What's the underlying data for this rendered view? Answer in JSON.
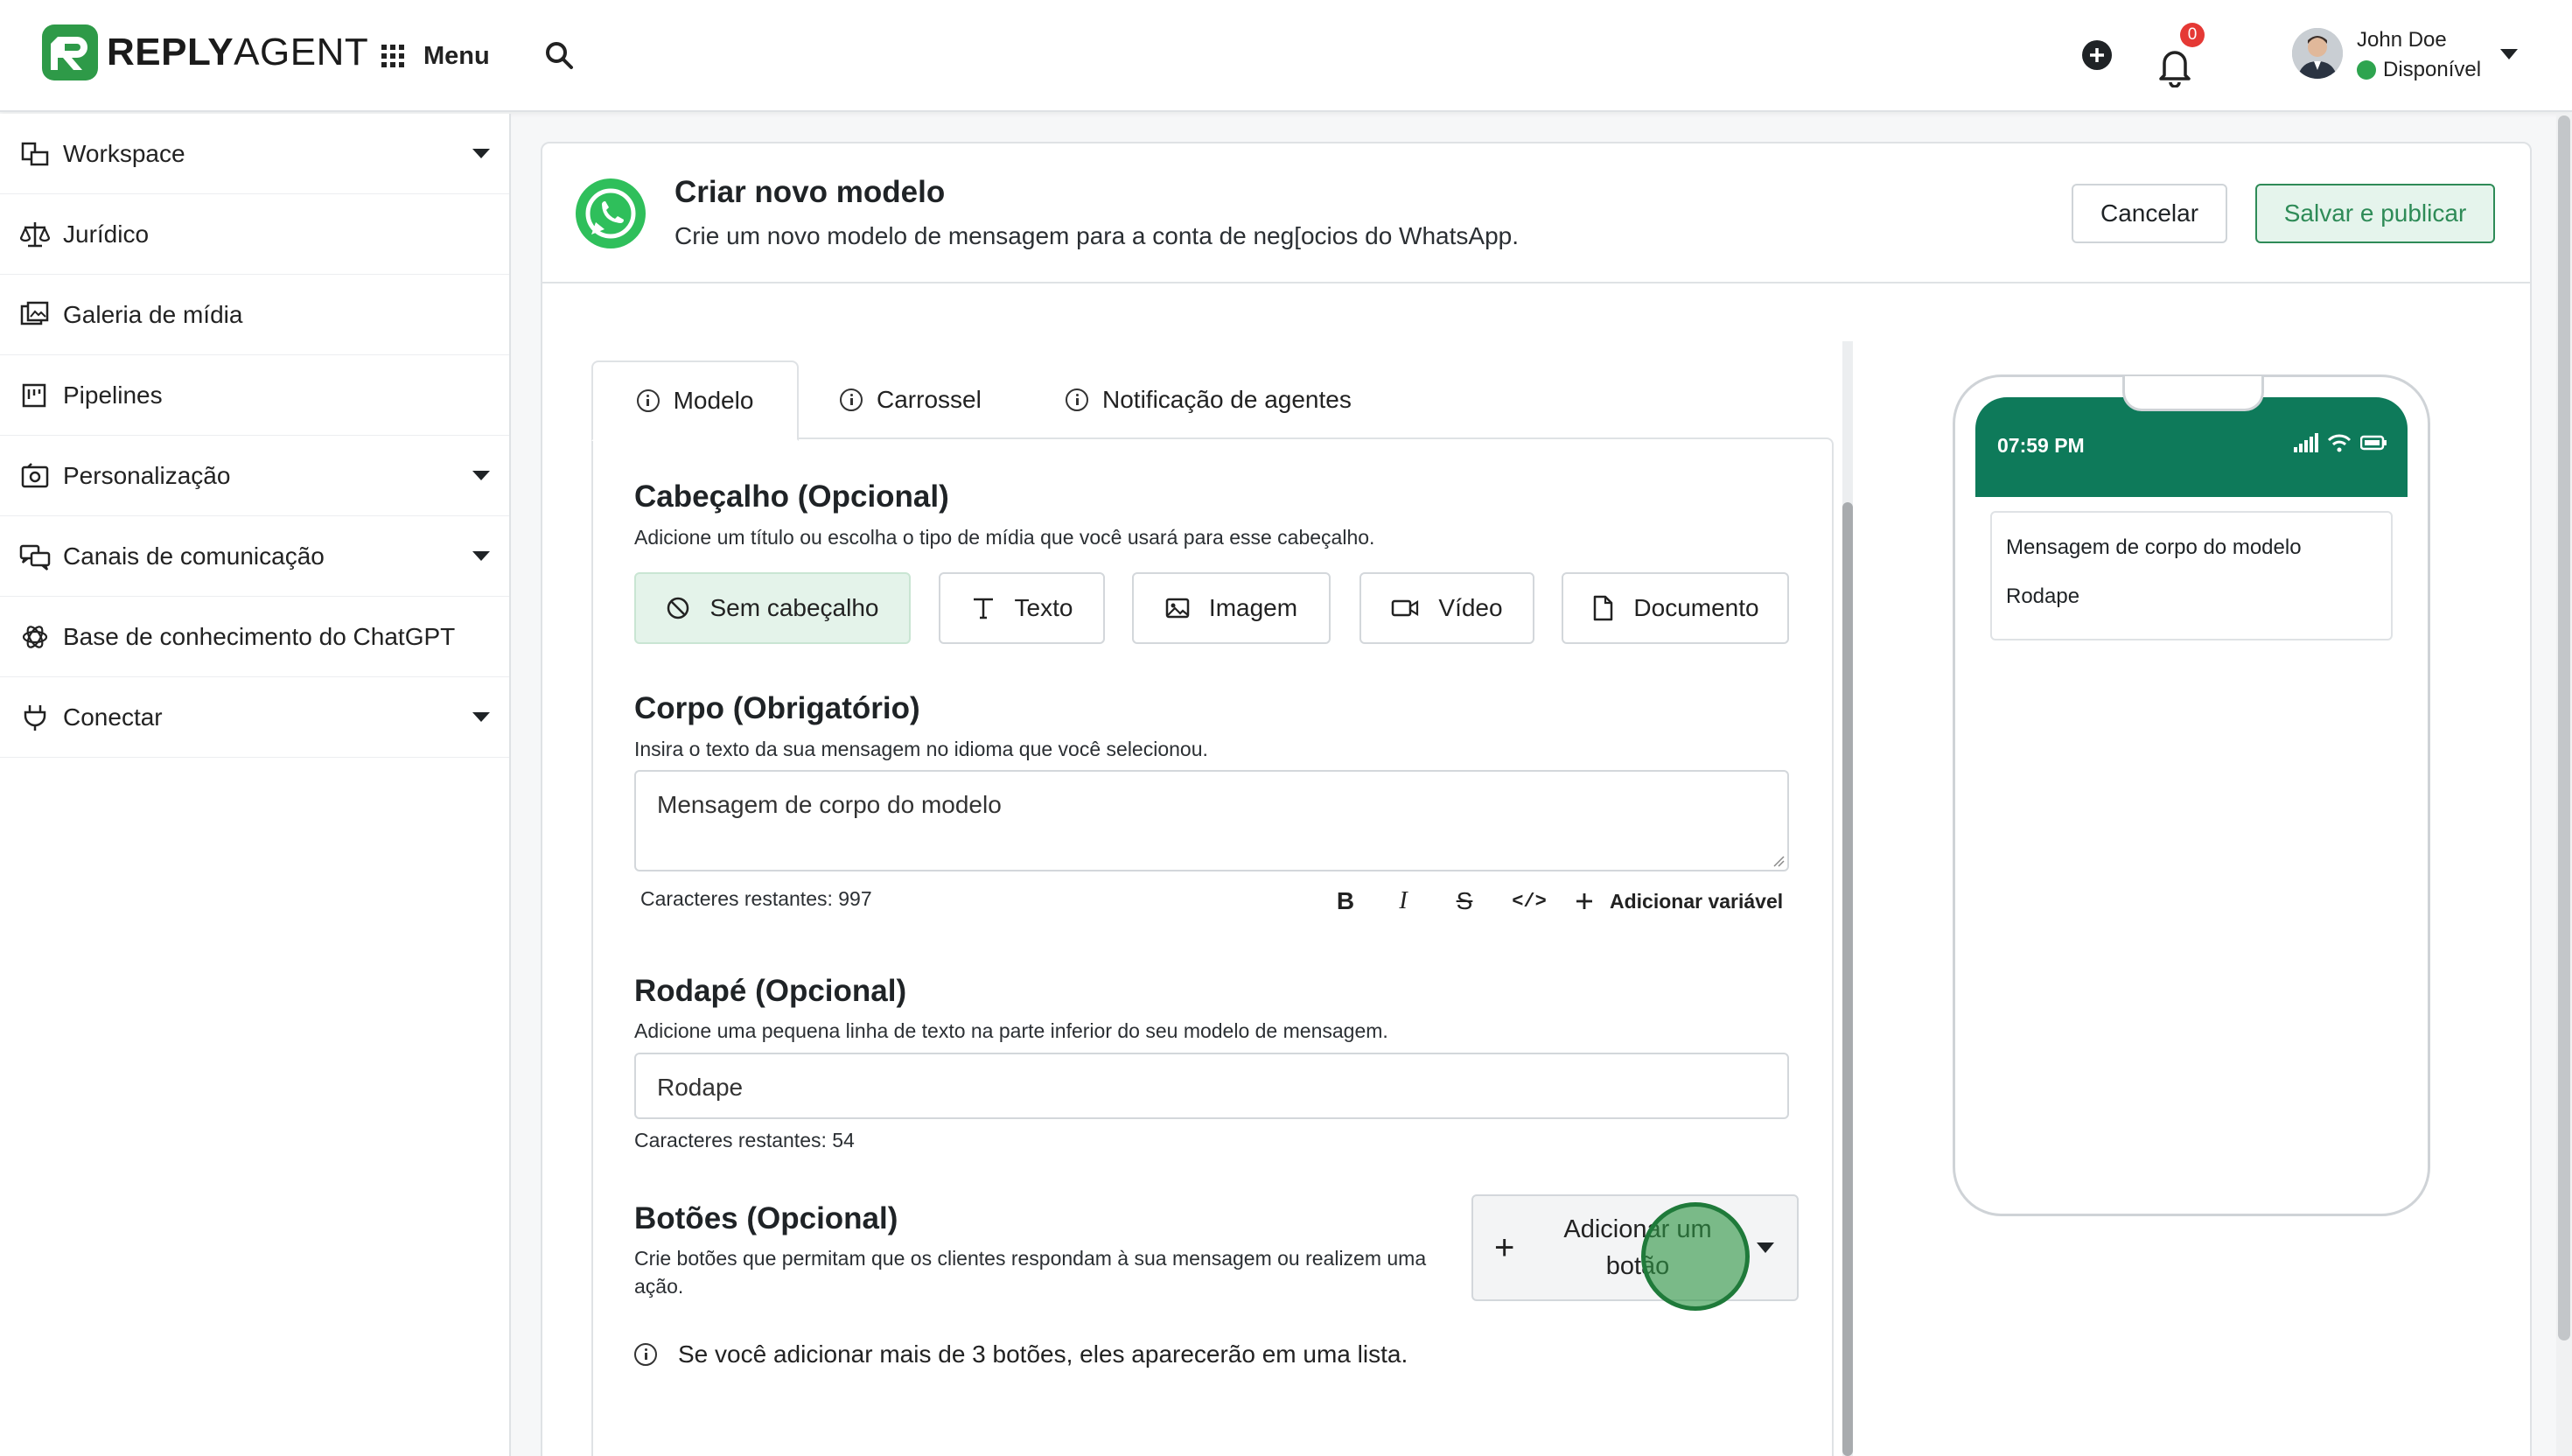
{
  "app": {
    "logo_bold": "REPLY",
    "logo_light": "AGENT",
    "menu_label": "Menu"
  },
  "header": {
    "notifications_count": "0",
    "user_name": "John Doe",
    "user_status": "Disponível"
  },
  "sidebar": {
    "items": [
      {
        "label": "Workspace",
        "icon": "workspace-icon",
        "expandable": true
      },
      {
        "label": "Jurídico",
        "icon": "scale-icon",
        "expandable": false
      },
      {
        "label": "Galeria de mídia",
        "icon": "media-gallery-icon",
        "expandable": false
      },
      {
        "label": "Pipelines",
        "icon": "kanban-icon",
        "expandable": false
      },
      {
        "label": "Personalização",
        "icon": "customize-icon",
        "expandable": true
      },
      {
        "label": "Canais de comunicação",
        "icon": "chat-channels-icon",
        "expandable": true
      },
      {
        "label": "Base de conhecimento do ChatGPT",
        "icon": "openai-icon",
        "expandable": false
      },
      {
        "label": "Conectar",
        "icon": "plug-icon",
        "expandable": true
      }
    ]
  },
  "page": {
    "title": "Criar novo modelo",
    "subtitle": "Crie um novo modelo de mensagem para a conta de neg[ocios do WhatsApp.",
    "cancel_label": "Cancelar",
    "publish_label": "Salvar e publicar"
  },
  "tabs": [
    {
      "label": "Modelo",
      "active": true
    },
    {
      "label": "Carrossel",
      "active": false
    },
    {
      "label": "Notificação de agentes",
      "active": false
    }
  ],
  "header_section": {
    "title": "Cabeçalho (Opcional)",
    "description": "Adicione um título ou escolha o tipo de mídia que você usará para esse cabeçalho.",
    "options": [
      "Sem cabeçalho",
      "Texto",
      "Imagem",
      "Vídeo",
      "Documento"
    ],
    "selected": "Sem cabeçalho"
  },
  "body_section": {
    "title": "Corpo (Obrigatório)",
    "description": "Insira o texto da sua mensagem no idioma que você selecionou.",
    "value": "Mensagem de corpo do modelo",
    "chars_remaining": "Caracteres restantes: 997",
    "format_bold": "B",
    "format_italic": "I",
    "format_strike": "S",
    "format_code": "</>",
    "add_variable_label": "Adicionar variável"
  },
  "footer_section": {
    "title": "Rodapé (Opcional)",
    "description": "Adicione uma pequena linha de texto na parte inferior do seu modelo de mensagem.",
    "value": "Rodape",
    "chars_remaining": "Caracteres restantes: 54"
  },
  "buttons_section": {
    "title": "Botões (Opcional)",
    "description": "Crie botões que permitam que os clientes respondam à sua mensagem ou realizem uma ação.",
    "add_button_label": "Adicionar um botão",
    "note": "Se você adicionar mais de 3 botões, eles aparecerão em uma lista."
  },
  "preview": {
    "time": "07:59 PM",
    "message_body": "Mensagem de corpo do modelo",
    "message_footer": "Rodape"
  },
  "colors": {
    "brand_green": "#2e9a48",
    "whatsapp_green": "#2fbf5b",
    "preview_header": "#0e7a5a",
    "publish_text": "#2e8b57",
    "badge_red": "#e53935"
  }
}
